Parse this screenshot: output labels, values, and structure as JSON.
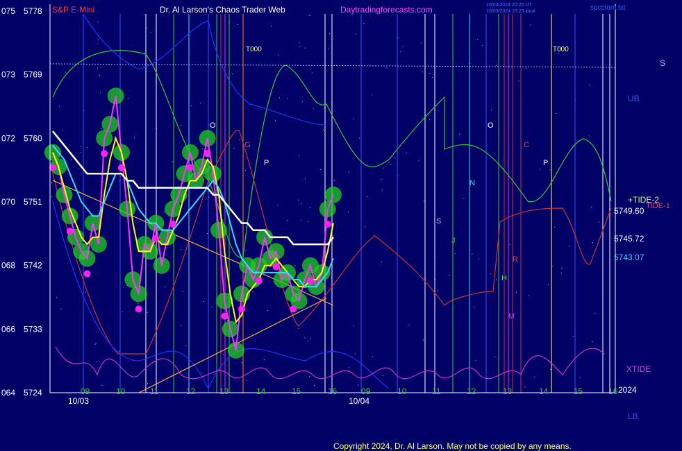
{
  "header": {
    "instrument": "S&P E-Mini",
    "title": "Dr. Al Larson's Chaos Trader Web",
    "site": "Daytradingforecasts.com",
    "stamp1": "10/03/2024 20:20 UT",
    "stamp2": "10/03/2024 15:20 local",
    "file": "spcctom.txt"
  },
  "footer": {
    "copyright": "Copyright 2024, Dr. Al Larson. May not be copied by any means."
  },
  "colors": {
    "background": "#000066",
    "price": "#ff33ff",
    "ma_fast": "#ffff00",
    "ma_mid": "#33ddff",
    "ma_slow": "#ffffff",
    "tide": "#cc33cc",
    "band": "#2233ff",
    "cloud": "#22cc22"
  },
  "chart_data": {
    "type": "line",
    "title": "S&P E-Mini",
    "ylabel": "",
    "xlabel": "",
    "ylim": [
      5724,
      5778
    ],
    "y_ticks": [
      {
        "left": "064",
        "price": 5724
      },
      {
        "left": "066",
        "price": 5733
      },
      {
        "left": "068",
        "price": 5742
      },
      {
        "left": "070",
        "price": 5751
      },
      {
        "left": "072",
        "price": 5760
      },
      {
        "left": "073",
        "price": 5769
      },
      {
        "left": "075",
        "price": 5778
      }
    ],
    "hour_ticks": [
      "09",
      "10",
      "11",
      "12",
      "13",
      "14",
      "15",
      "16",
      "09",
      "10",
      "11",
      "12",
      "13",
      "14",
      "15",
      "16"
    ],
    "date_labels": [
      "10/03",
      "10/04"
    ],
    "year_label": "2024",
    "price_labels": {
      "tide2": "+TIDE-2",
      "tide": "TIDE-1",
      "xtide": "XTIDE",
      "s": "S",
      "ub": "UB",
      "lb": "LB",
      "v1": "5749.60",
      "v2": "5745.72",
      "v3": "5743.07"
    },
    "markers": [
      "T000",
      "O",
      "C",
      "P",
      "N",
      "S",
      "J",
      "R",
      "H",
      "M",
      "T000",
      "O",
      "C",
      "P"
    ],
    "series": [
      {
        "name": "price",
        "values": [
          5758,
          5756,
          5752,
          5749,
          5746,
          5744,
          5743,
          5748,
          5745,
          5760,
          5762,
          5766,
          5758,
          5750,
          5740,
          5738,
          5745,
          5744,
          5748,
          5742,
          5746,
          5750,
          5752,
          5755,
          5758,
          5754,
          5756,
          5760,
          5755,
          5747,
          5737,
          5733,
          5730,
          5738,
          5742,
          5740,
          5742,
          5746,
          5743,
          5744,
          5740,
          5741,
          5738,
          5737,
          5740,
          5742,
          5739,
          5741,
          5750,
          5752
        ]
      },
      {
        "name": "ma-fast",
        "values": [
          5758,
          5756,
          5753,
          5750,
          5748,
          5746,
          5745,
          5746,
          5746,
          5752,
          5757,
          5760,
          5758,
          5754,
          5748,
          5744,
          5744,
          5744,
          5746,
          5745,
          5745,
          5747,
          5749,
          5752,
          5754,
          5754,
          5755,
          5757,
          5756,
          5752,
          5744,
          5738,
          5734,
          5735,
          5738,
          5739,
          5740,
          5742,
          5742,
          5743,
          5742,
          5741,
          5740,
          5739,
          5739,
          5740,
          5740,
          5741,
          5744,
          5748
        ]
      },
      {
        "name": "ma-mid",
        "values": [
          5759,
          5758,
          5757,
          5755,
          5753,
          5751,
          5750,
          5749,
          5749,
          5751,
          5753,
          5755,
          5755,
          5754,
          5752,
          5750,
          5749,
          5748,
          5748,
          5747,
          5747,
          5747,
          5748,
          5749,
          5750,
          5751,
          5752,
          5753,
          5754,
          5753,
          5751,
          5748,
          5745,
          5743,
          5742,
          5741,
          5741,
          5741,
          5741,
          5741,
          5741,
          5741,
          5740,
          5740,
          5739,
          5739,
          5739,
          5740,
          5741,
          5743
        ]
      },
      {
        "name": "ma-slow",
        "values": [
          5761,
          5760,
          5759,
          5758,
          5757,
          5756,
          5755,
          5755,
          5755,
          5755,
          5755,
          5755,
          5755,
          5754,
          5754,
          5753,
          5753,
          5753,
          5753,
          5753,
          5753,
          5753,
          5753,
          5753,
          5753,
          5753,
          5753,
          5753,
          5752,
          5752,
          5751,
          5750,
          5749,
          5748,
          5748,
          5747,
          5747,
          5747,
          5746,
          5746,
          5746,
          5746,
          5745,
          5745,
          5745,
          5745,
          5745,
          5745,
          5745,
          5746
        ]
      }
    ]
  }
}
